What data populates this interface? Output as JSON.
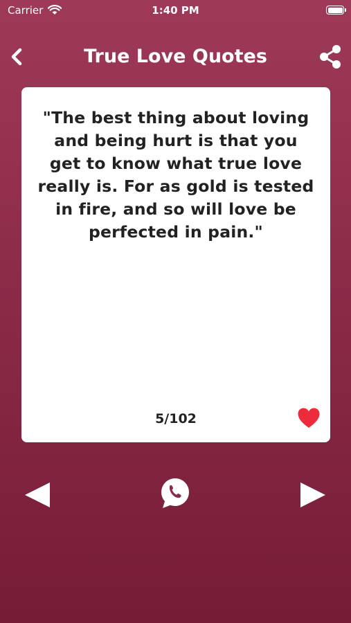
{
  "status_bar": {
    "carrier": "Carrier",
    "time": "1:40 PM"
  },
  "nav": {
    "title": "True Love Quotes",
    "back_icon": "chevron-left-icon",
    "share_icon": "share-icon"
  },
  "quote": {
    "text": "\"The best thing about loving and being hurt is that you get to know what true love really is. For as gold is tested in fire, and so will love be perfected in pain.\"",
    "counter": "5/102",
    "favorite_icon": "heart-icon",
    "favorite_color": "#ee2b3a"
  },
  "controls": {
    "prev_icon": "triangle-left-icon",
    "whatsapp_icon": "whatsapp-icon",
    "next_icon": "triangle-right-icon"
  },
  "colors": {
    "background_top": "#9e3a58",
    "background_bottom": "#761c36",
    "card": "#ffffff"
  }
}
